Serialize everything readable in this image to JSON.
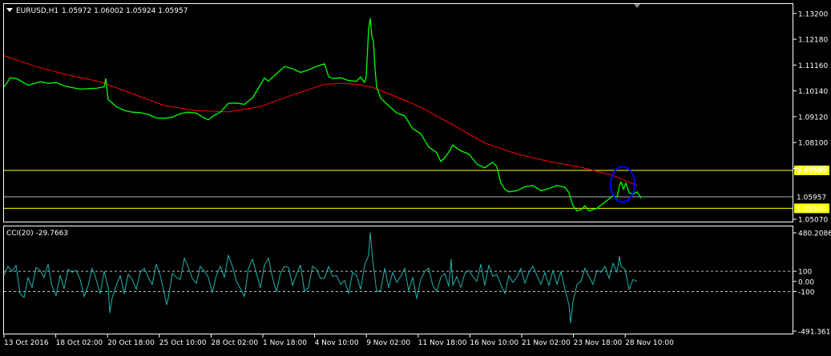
{
  "header": {
    "menu_arrow": "triangle-down-icon",
    "symbol": "EURUSD,H1",
    "ohlc": "1.05972 1.06002 1.05924 1.05957"
  },
  "indicator": {
    "label": "CCI(20) -29.7663"
  },
  "colors": {
    "background": "#000000",
    "price": "#00ff00",
    "ma": "#ff0000",
    "cci": "#20b2aa",
    "hline": "#ffff00",
    "bid_line": "#b0b0b0",
    "ellipse": "#0000ff",
    "label_bg": "#ffff00"
  },
  "chart_data": [
    {
      "type": "line",
      "title": "EURUSD,H1",
      "ylim": [
        1.0507,
        1.1332
      ],
      "y_ticks": [
        "1.13200",
        "1.12180",
        "1.11160",
        "1.10140",
        "1.09120",
        "1.08100",
        "1.07080",
        "1.05957",
        "1.05500",
        "1.05070"
      ],
      "x_ticks": [
        "13 Oct 2016",
        "18 Oct 02:00",
        "20 Oct 18:00",
        "25 Oct 10:00",
        "28 Oct 02:00",
        "1 Nov 18:00",
        "4 Nov 10:00",
        "9 Nov 02:00",
        "11 Nov 18:00",
        "16 Nov 10:00",
        "21 Nov 02:00",
        "23 Nov 18:00",
        "28 Nov 10:00"
      ],
      "series": [
        {
          "key": "price",
          "x": [
            0,
            8,
            16,
            30,
            45,
            55,
            65,
            75,
            85,
            95,
            105,
            115,
            125,
            127,
            130,
            140,
            150,
            160,
            170,
            180,
            190,
            200,
            210,
            220,
            230,
            240,
            250,
            255,
            260,
            270,
            280,
            290,
            300,
            310,
            320,
            325,
            330,
            340,
            350,
            360,
            370,
            380,
            390,
            400,
            405,
            410,
            420,
            430,
            440,
            445,
            450,
            452,
            455,
            457,
            459,
            461,
            463,
            465,
            470,
            480,
            490,
            500,
            510,
            520,
            530,
            540,
            545,
            550,
            555,
            560,
            570,
            580,
            590,
            600,
            605,
            610,
            615,
            620,
            625,
            630,
            640,
            650,
            660,
            670,
            680,
            690,
            700,
            705,
            710,
            715,
            720,
            725,
            730,
            740,
            750,
            760,
            765,
            768,
            770,
            773,
            776,
            780,
            785,
            790,
            795
          ],
          "values": [
            1.103,
            1.1066,
            1.1062,
            1.1036,
            1.105,
            1.1044,
            1.1047,
            1.1034,
            1.1027,
            1.1021,
            1.1023,
            1.1024,
            1.103,
            1.1062,
            1.098,
            1.0952,
            1.0937,
            1.093,
            1.0928,
            1.0921,
            1.0907,
            1.0906,
            1.091,
            1.0924,
            1.093,
            1.0926,
            1.0907,
            1.09,
            1.0913,
            1.093,
            1.0965,
            1.0966,
            1.0961,
            1.0986,
            1.1038,
            1.1065,
            1.1053,
            1.1082,
            1.111,
            1.1102,
            1.1087,
            1.1097,
            1.1111,
            1.1121,
            1.1071,
            1.1063,
            1.1066,
            1.1055,
            1.1052,
            1.1069,
            1.1047,
            1.107,
            1.126,
            1.13,
            1.123,
            1.121,
            1.11,
            1.103,
            1.0985,
            1.0956,
            1.0927,
            1.0915,
            1.0865,
            1.0845,
            1.0792,
            1.077,
            1.0735,
            1.075,
            1.0772,
            1.08,
            1.0777,
            1.0765,
            1.0725,
            1.071,
            1.0722,
            1.0732,
            1.0715,
            1.065,
            1.0625,
            1.0615,
            1.062,
            1.0635,
            1.064,
            1.062,
            1.0628,
            1.064,
            1.0633,
            1.0612,
            1.056,
            1.054,
            1.0545,
            1.056,
            1.054,
            1.055,
            1.0575,
            1.06,
            1.0595,
            1.064,
            1.0655,
            1.0625,
            1.065,
            1.0612,
            1.0605,
            1.0615,
            1.059
          ]
        },
        {
          "key": "ma",
          "x": [
            0,
            40,
            80,
            120,
            160,
            200,
            240,
            280,
            320,
            360,
            400,
            420,
            440,
            460,
            480,
            520,
            560,
            600,
            640,
            680,
            720,
            760,
            790
          ],
          "values": [
            1.1153,
            1.111,
            1.1077,
            1.105,
            1.1003,
            1.0956,
            1.0936,
            1.0931,
            1.0952,
            1.0998,
            1.104,
            1.1044,
            1.104,
            1.1028,
            1.1003,
            1.095,
            1.088,
            1.0808,
            1.0765,
            1.0735,
            1.0712,
            1.068,
            1.064
          ]
        }
      ],
      "horizontal_lines": [
        {
          "value": 1.07,
          "label": "1.07000",
          "color": "#ffff00"
        },
        {
          "value": 1.055,
          "label": "1.05500",
          "color": "#ffff00"
        },
        {
          "value": 1.05957,
          "label": "1.05957",
          "color": "#b0b0b0"
        }
      ]
    },
    {
      "type": "line",
      "title": "CCI(20) -29.7663",
      "ylim": [
        -491.3611,
        480.2086
      ],
      "y_ticks": [
        "480.2086",
        "100",
        "0.00",
        "-100",
        "-491.3611"
      ],
      "series": [
        {
          "key": "cci",
          "x": [
            0,
            5,
            10,
            15,
            20,
            25,
            30,
            35,
            40,
            45,
            50,
            55,
            60,
            65,
            70,
            75,
            80,
            85,
            90,
            95,
            100,
            105,
            110,
            115,
            120,
            125,
            130,
            132,
            135,
            140,
            145,
            150,
            155,
            160,
            165,
            170,
            175,
            180,
            185,
            190,
            195,
            200,
            203,
            205,
            210,
            215,
            220,
            225,
            230,
            235,
            240,
            245,
            250,
            255,
            260,
            265,
            270,
            275,
            280,
            285,
            290,
            295,
            300,
            305,
            310,
            315,
            320,
            325,
            330,
            335,
            340,
            345,
            350,
            355,
            360,
            365,
            370,
            375,
            380,
            385,
            390,
            395,
            400,
            405,
            410,
            415,
            420,
            425,
            430,
            435,
            440,
            445,
            450,
            455,
            457,
            460,
            465,
            470,
            475,
            480,
            485,
            490,
            495,
            500,
            505,
            510,
            515,
            520,
            525,
            530,
            535,
            540,
            545,
            550,
            555,
            558,
            560,
            565,
            570,
            575,
            580,
            585,
            590,
            595,
            600,
            605,
            610,
            615,
            620,
            625,
            630,
            635,
            640,
            645,
            650,
            655,
            660,
            665,
            670,
            675,
            680,
            685,
            690,
            695,
            700,
            705,
            707,
            710,
            715,
            720,
            725,
            730,
            735,
            740,
            745,
            750,
            755,
            760,
            765,
            768,
            770,
            775,
            780,
            785,
            790
          ],
          "values": [
            60,
            150,
            100,
            160,
            -120,
            -160,
            40,
            -60,
            140,
            110,
            40,
            170,
            -50,
            -140,
            60,
            -70,
            120,
            90,
            110,
            20,
            -150,
            -40,
            130,
            20,
            -120,
            100,
            -60,
            -310,
            -160,
            -40,
            60,
            -120,
            70,
            20,
            -80,
            90,
            130,
            40,
            -30,
            170,
            60,
            -120,
            -230,
            -160,
            80,
            40,
            20,
            230,
            140,
            30,
            -20,
            150,
            100,
            40,
            -110,
            60,
            150,
            40,
            260,
            150,
            0,
            -70,
            -150,
            130,
            220,
            80,
            -60,
            160,
            230,
            40,
            -100,
            80,
            150,
            140,
            -40,
            70,
            160,
            -100,
            -60,
            150,
            120,
            30,
            30,
            150,
            50,
            60,
            -30,
            10,
            -120,
            90,
            60,
            -80,
            160,
            260,
            480,
            220,
            -100,
            -90,
            130,
            -60,
            90,
            -10,
            50,
            130,
            -90,
            40,
            -170,
            20,
            100,
            130,
            -40,
            -100,
            40,
            80,
            -50,
            220,
            -40,
            50,
            -60,
            80,
            110,
            50,
            0,
            170,
            -40,
            160,
            50,
            70,
            -30,
            -120,
            60,
            -10,
            40,
            130,
            -20,
            90,
            150,
            60,
            -30,
            90,
            -40,
            110,
            -30,
            100,
            -80,
            -230,
            -410,
            -200,
            -30,
            0,
            130,
            50,
            -30,
            110,
            90,
            150,
            30,
            180,
            90,
            250,
            150,
            120,
            -80,
            20,
            0
          ]
        }
      ],
      "horizontal_lines": [
        {
          "value": 100,
          "label": "100"
        },
        {
          "value": -100,
          "label": "-100"
        }
      ]
    }
  ]
}
